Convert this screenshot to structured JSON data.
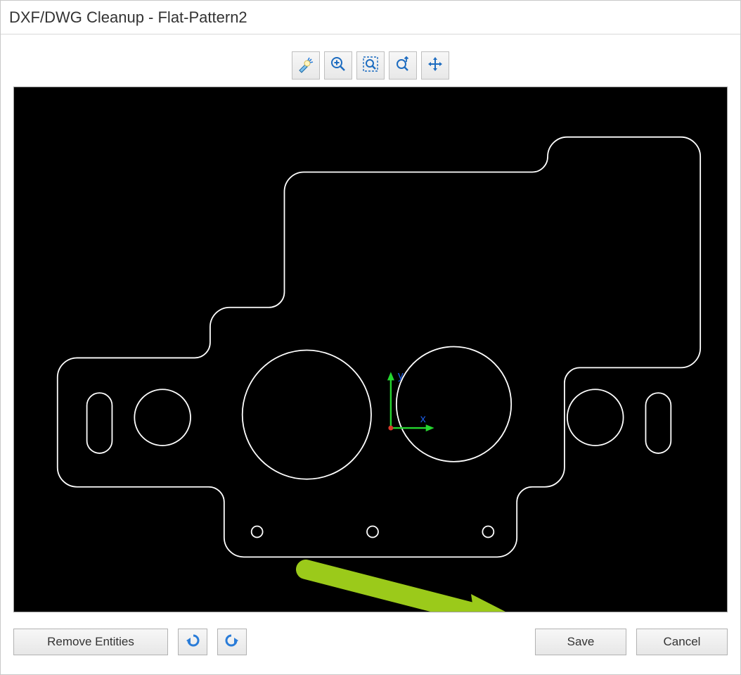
{
  "window": {
    "title": "DXF/DWG Cleanup - Flat-Pattern2"
  },
  "toolbar": {
    "highlight_tool": "highlight",
    "zoom_in_tool": "zoom-in",
    "zoom_fit_tool": "zoom-fit",
    "zoom_height_tool": "zoom-height",
    "pan_tool": "pan"
  },
  "viewport": {
    "axis_x_label": "x",
    "axis_y_label": "y"
  },
  "footer": {
    "remove_entities_label": "Remove Entities",
    "undo_label": "Undo",
    "redo_label": "Redo",
    "save_label": "Save",
    "cancel_label": "Cancel"
  }
}
